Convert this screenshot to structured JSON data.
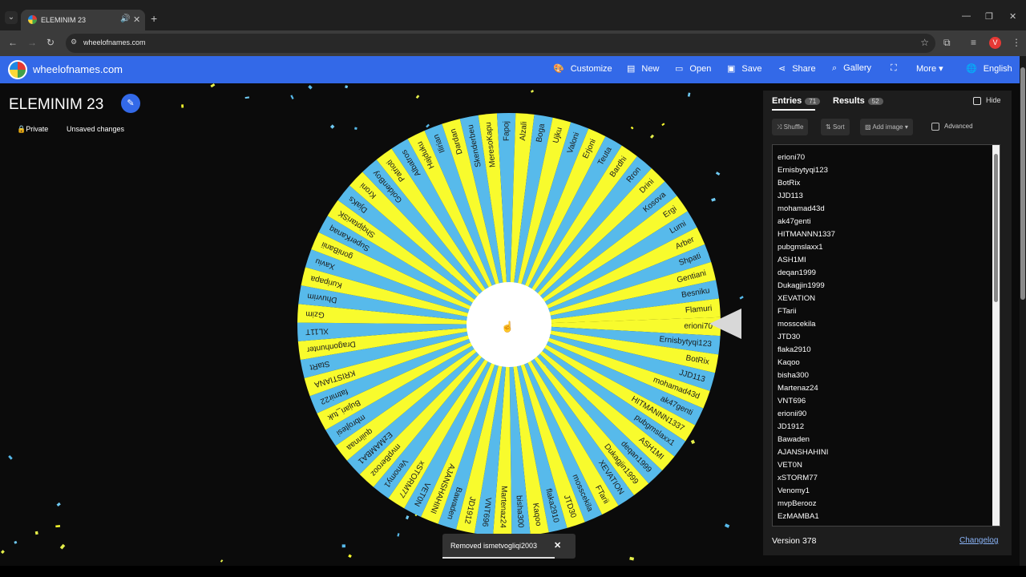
{
  "browser": {
    "tab_title": "ELEMINIM 23",
    "url": "wheelofnames.com",
    "profile_initial": "V"
  },
  "appbar": {
    "brand": "wheelofnames.com",
    "menu": [
      "Customize",
      "New",
      "Open",
      "Save",
      "Share",
      "Gallery",
      "More",
      "English"
    ]
  },
  "wheel": {
    "title": "ELEMINIM 23",
    "privacy": "Private",
    "status": "Unsaved changes",
    "colors": [
      "#f8fb2d",
      "#57baeb"
    ],
    "segments": [
      "erioni70",
      "Ernisbytyqi123",
      "BotRix",
      "JJD113",
      "mohamad43d",
      "ak47genti",
      "HITMANNN1337",
      "pubgmslaxx1",
      "ASH1MI",
      "deqan1999",
      "Dukagjin1999",
      "XEVATION",
      "FTarii",
      "mosscekila",
      "JTD30",
      "flaka2910",
      "Kaqoo",
      "bisha300",
      "Martenaz24",
      "VNT696",
      "JD1912",
      "Bawaden",
      "AJANSHAHINI",
      "VET0N",
      "xSTORM77",
      "Venomy1",
      "mvpBerooz",
      "EzMAMBA1",
      "quiinnaa",
      "mbrojtesi",
      "Bujari_tuk",
      "fatmir22",
      "KRISTIANA",
      "StaRt",
      "Dragonhunter",
      "XL11T",
      "Gzim",
      "Dhuvrim",
      "Kuripapa",
      "Xaviu",
      "goniBanii",
      "SuperKanaq",
      "ShqiptariSK",
      "DjaKs",
      "Kroni",
      "GoldenBoy",
      "Patrioti",
      "Albatros",
      "Hajduku",
      "Ilirian",
      "Dardan",
      "Skenderbeu",
      "MeresoKapu",
      "Fapoj",
      "Alzali",
      "Boga",
      "Ujku",
      "Valoni",
      "Erjoni",
      "Teuta",
      "Bardhi",
      "Rron",
      "Drini",
      "Kosova",
      "Ergi",
      "Lumi",
      "Arber",
      "Shpati",
      "Gentiani",
      "Besniku",
      "Flamuri"
    ]
  },
  "sidebar": {
    "tab_entries": "Entries",
    "entries_count": "71",
    "tab_results": "Results",
    "results_count": "52",
    "hide_label": "Hide",
    "shuffle": "Shuffle",
    "sort": "Sort",
    "add_image": "Add image",
    "advanced": "Advanced",
    "entries": [
      "erioni70",
      "Ernisbytyqi123",
      "BotRix",
      "JJD113",
      "mohamad43d",
      "ak47genti",
      "HITMANNN1337",
      "pubgmslaxx1",
      "ASH1MI",
      "deqan1999",
      "Dukagjin1999",
      "XEVATION",
      "FTarii",
      "mosscekila",
      "JTD30",
      "flaka2910",
      "Kaqoo",
      "bisha300",
      "Martenaz24",
      "VNT696",
      "erionii90",
      "JD1912",
      "Bawaden",
      "AJANSHAHINI",
      "VET0N",
      "xSTORM77",
      "Venomy1",
      "mvpBerooz",
      "EzMAMBA1"
    ],
    "version": "Version 378",
    "changelog": "Changelog"
  },
  "toast": {
    "message": "Removed ismetvogliqi2003"
  },
  "icons": {
    "customize": "palette-icon",
    "new": "file-icon",
    "open": "folder-icon",
    "save": "save-icon",
    "share": "share-icon",
    "gallery": "search-icon",
    "fullscreen": "fullscreen-icon",
    "language": "globe-icon"
  }
}
